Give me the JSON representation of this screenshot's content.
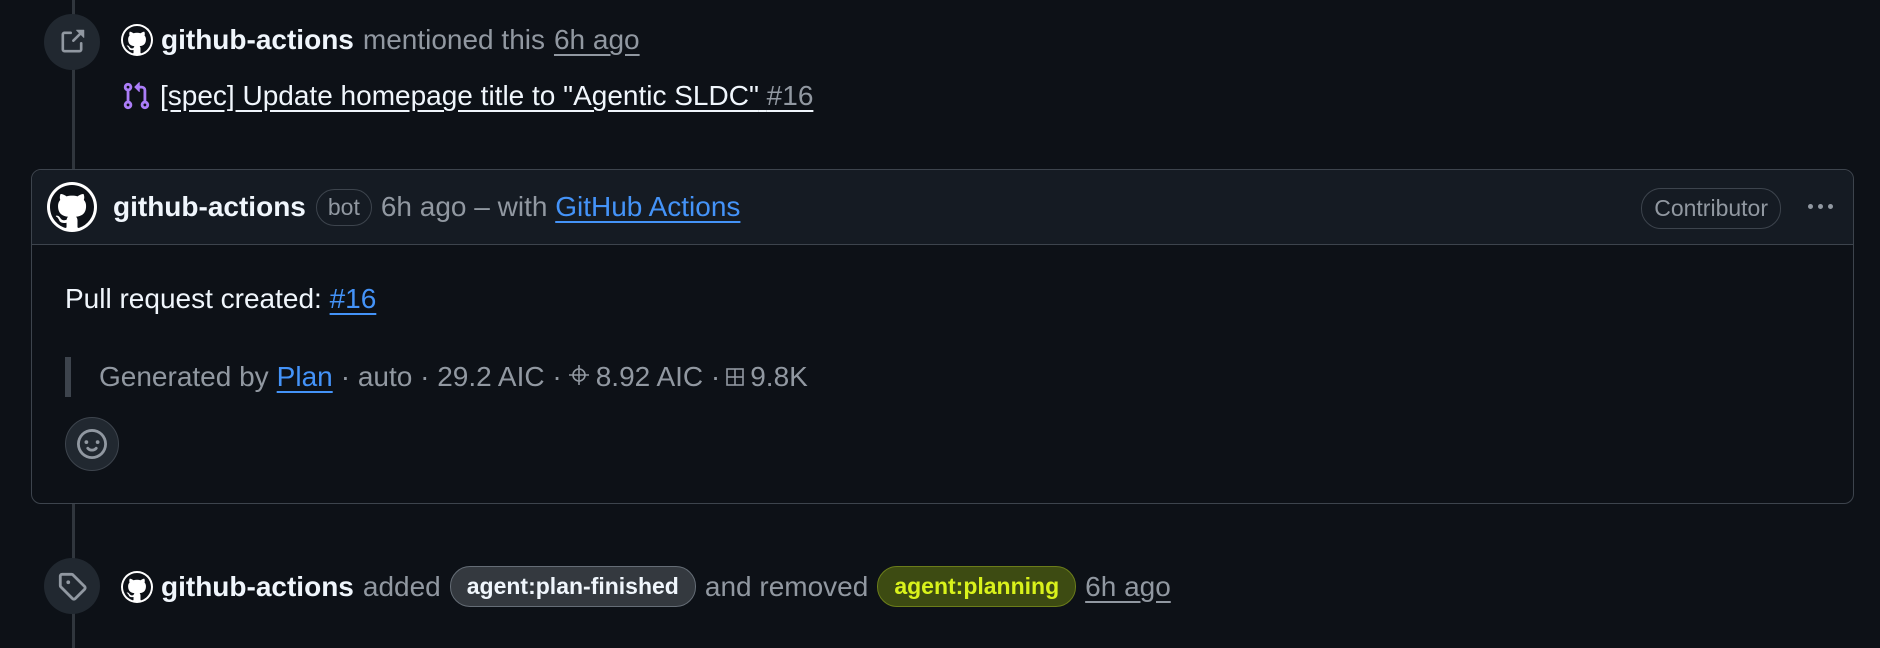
{
  "events": {
    "mention": {
      "actor": "github-actions",
      "action": "mentioned this",
      "time": "6h ago",
      "ref_title": "[spec] Update homepage title to \"Agentic SLDC\"",
      "ref_number": "#16"
    },
    "labels": {
      "actor": "github-actions",
      "added_text": "added",
      "added_label": "agent:plan-finished",
      "removed_text": "and removed",
      "removed_label": "agent:planning",
      "time": "6h ago"
    }
  },
  "comment": {
    "author": "github-actions",
    "bot_badge": "bot",
    "time": "6h ago",
    "with_text": "– with",
    "app_link": "GitHub Actions",
    "role_badge": "Contributor",
    "body_prefix": "Pull request created:",
    "body_link": "#16",
    "quote": {
      "prefix": "Generated by",
      "link": "Plan",
      "part1": "· auto · 29.2 AIC ·",
      "part2": "8.92 AIC ·",
      "part3": "9.8K"
    }
  },
  "colors": {
    "background": "#0d1117",
    "link_blue": "#4493f8",
    "muted": "#9198a1",
    "label_green_text": "#d9f21b",
    "pr_icon": "#ab7df8"
  },
  "icons": [
    "link-external-icon",
    "pull-request-icon",
    "github-logo-icon",
    "kebab-icon",
    "smiley-icon",
    "tag-icon",
    "crosshair-icon",
    "grid-icon"
  ]
}
